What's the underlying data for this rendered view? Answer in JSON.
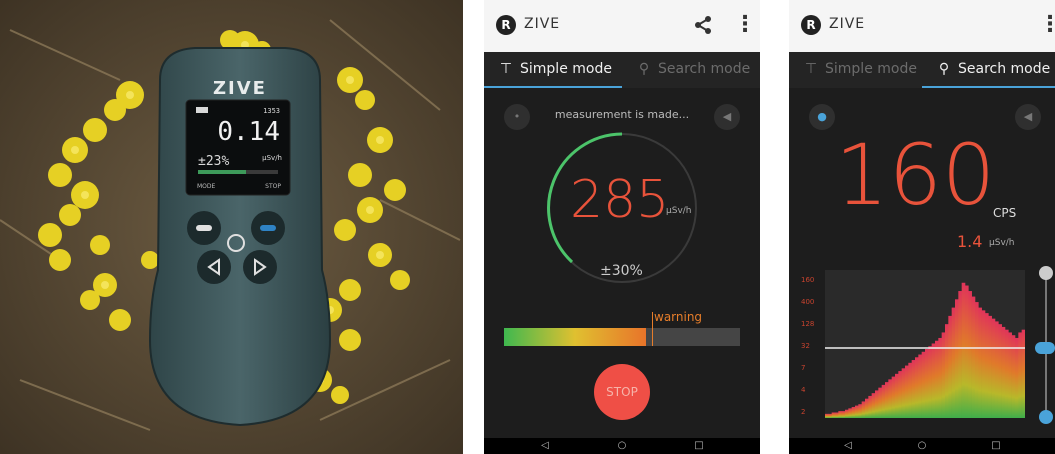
{
  "photo": {
    "device_brand": "ZIVE",
    "device_screen": {
      "top_right": "1353",
      "value": "0.14",
      "unit": "µSv/h",
      "percent": "±23%",
      "label_mode": "MODE",
      "label_stop": "STOP"
    }
  },
  "phone1": {
    "app_title": "ZIVE",
    "tabs": [
      {
        "label": "Simple mode",
        "icon": "pin-icon",
        "active": true
      },
      {
        "label": "Search mode",
        "icon": "search-icon",
        "active": false
      }
    ],
    "status": "measurement is made...",
    "value": "285",
    "unit": "µSv/h",
    "accuracy": "±30%",
    "warning_label": "warning",
    "level_fraction": 0.6,
    "stop_label": "STOP",
    "colors": {
      "accent": "#4aa3d9",
      "value": "#e8533b",
      "stop": "#ef4f46",
      "gauge": "#4cc46a"
    }
  },
  "phone2": {
    "app_title": "ZIVE",
    "tabs": [
      {
        "label": "Simple mode",
        "icon": "pin-icon",
        "active": false
      },
      {
        "label": "Search mode",
        "icon": "search-icon",
        "active": true
      }
    ],
    "value": "160",
    "value_unit": "CPS",
    "dose": "1.4",
    "dose_unit": "µSv/h",
    "y_ticks": [
      "160",
      "400",
      "128",
      "32",
      "7",
      "4",
      "2"
    ],
    "chart_data": {
      "type": "area",
      "title": "",
      "xlabel": "",
      "ylabel": "",
      "y_tick_labels": [
        "160",
        "400",
        "128",
        "32",
        "7",
        "4",
        "2"
      ],
      "threshold_tick": "32",
      "series": [
        {
          "values": [
            3,
            3,
            4,
            4,
            5,
            5,
            6,
            7,
            8,
            9,
            10,
            12,
            14,
            16,
            18,
            20,
            22,
            24,
            26,
            28,
            30,
            32,
            34,
            36,
            38,
            40,
            42,
            44,
            46,
            48,
            50,
            52,
            54,
            56,
            58,
            62,
            68,
            74,
            80,
            86,
            92,
            98,
            96,
            92,
            88,
            84,
            80,
            78,
            76,
            74,
            72,
            70,
            68,
            66,
            64,
            62,
            60,
            58,
            62,
            64
          ]
        }
      ]
    }
  }
}
